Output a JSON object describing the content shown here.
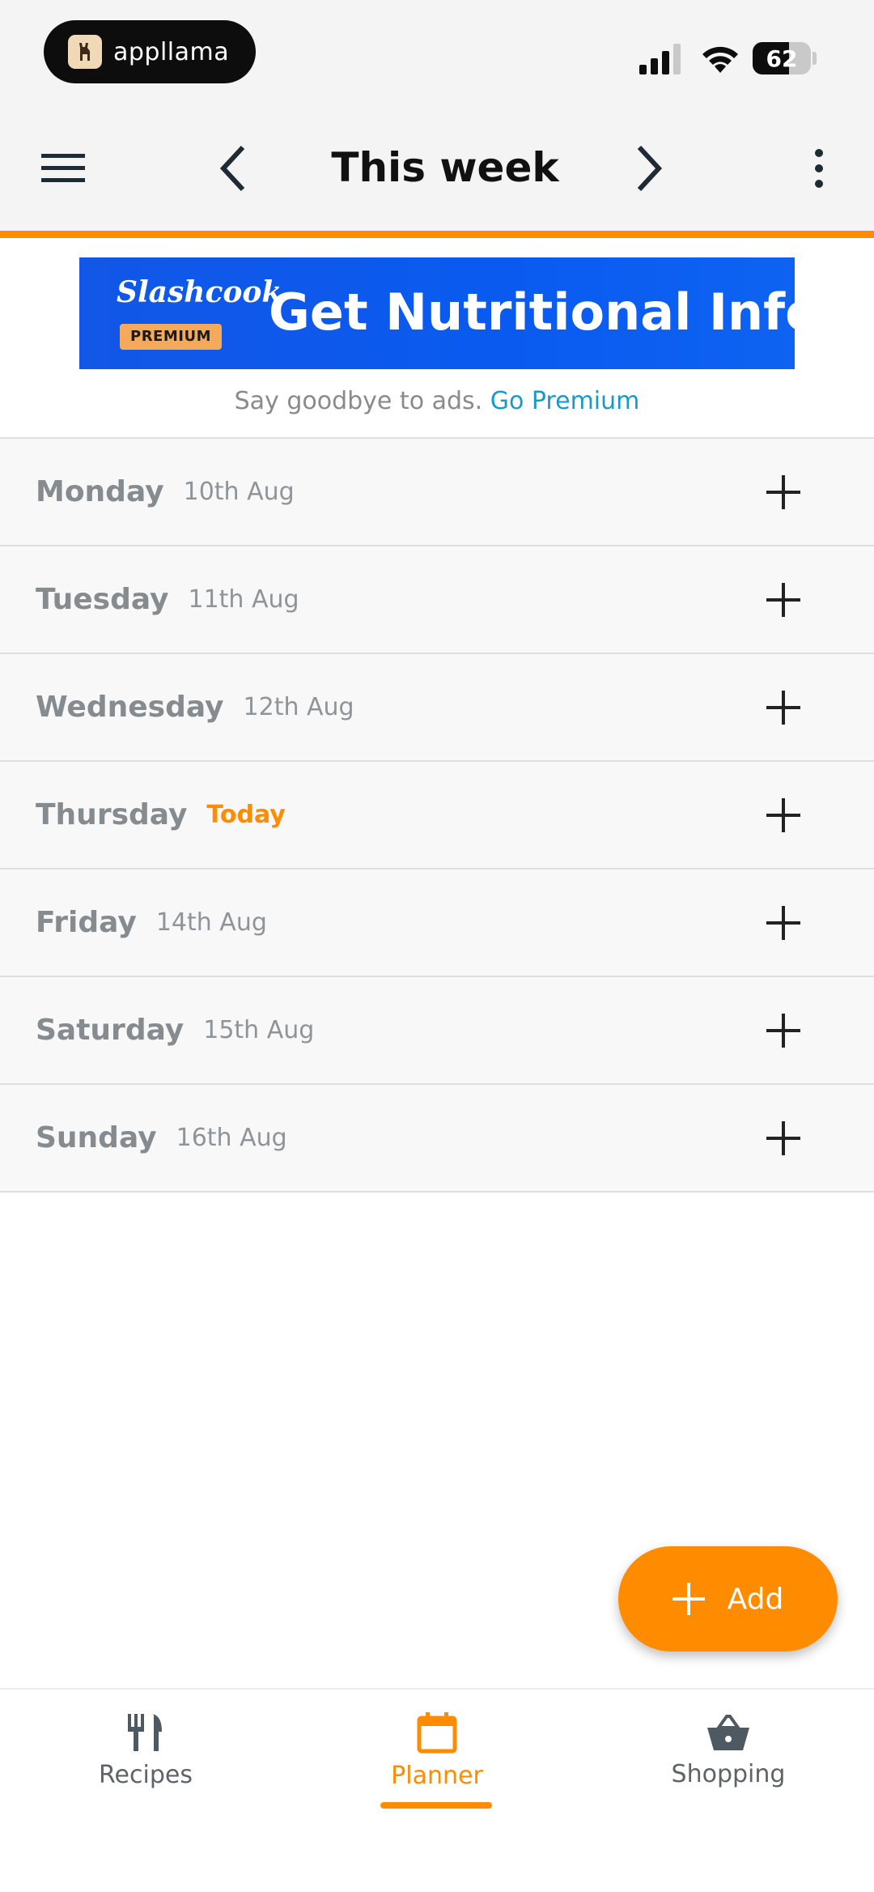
{
  "status_bar": {
    "pill_text": "appllama",
    "battery_level": 62,
    "battery_text": "62"
  },
  "header": {
    "title": "This week",
    "accent_color": "#ff8c00"
  },
  "ad": {
    "brand": "Slashcook",
    "badge": "PREMIUM",
    "headline": "Get Nutritional Info",
    "caption": "Say goodbye to ads.",
    "caption_link": "Go Premium"
  },
  "days": [
    {
      "name": "Monday",
      "date": "10th Aug",
      "is_today": false
    },
    {
      "name": "Tuesday",
      "date": "11th Aug",
      "is_today": false
    },
    {
      "name": "Wednesday",
      "date": "12th Aug",
      "is_today": false
    },
    {
      "name": "Thursday",
      "date": "Today",
      "is_today": true
    },
    {
      "name": "Friday",
      "date": "14th Aug",
      "is_today": false
    },
    {
      "name": "Saturday",
      "date": "15th Aug",
      "is_today": false
    },
    {
      "name": "Sunday",
      "date": "16th Aug",
      "is_today": false
    }
  ],
  "fab": {
    "label": "Add",
    "icon": "plus-icon"
  },
  "nav": {
    "recipes": {
      "label": "Recipes",
      "icon": "fork-knife-icon"
    },
    "planner": {
      "label": "Planner",
      "icon": "calendar-icon",
      "active": true
    },
    "shopping": {
      "label": "Shopping",
      "icon": "basket-icon"
    }
  }
}
